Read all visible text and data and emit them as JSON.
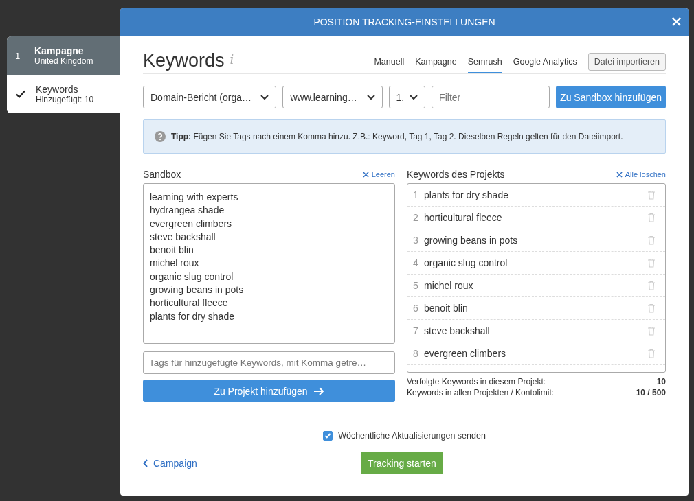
{
  "steps": [
    {
      "number": "1",
      "title": "Kampagne",
      "subtitle": "United Kingdom",
      "done": false,
      "selected": true
    },
    {
      "title": "Keywords",
      "subtitle": "Hinzugefügt: 10",
      "done": true,
      "selected": false
    }
  ],
  "dialog": {
    "title": "POSITION TRACKING-EINSTELLUNGEN"
  },
  "heading": "Keywords",
  "info_icon": "i",
  "tabs": [
    {
      "label": "Manuell",
      "selected": false
    },
    {
      "label": "Kampagne",
      "selected": false
    },
    {
      "label": "Semrush",
      "selected": true
    },
    {
      "label": "Google Analytics",
      "selected": false
    }
  ],
  "import_button": "Datei importieren",
  "selects": [
    {
      "value": "Domain-Bericht (orga…"
    },
    {
      "value": "www.learning…"
    },
    {
      "value": "1."
    }
  ],
  "filter": {
    "placeholder": "Filter"
  },
  "sandbox_button": "Zu Sandbox hinzufügen",
  "tip": "**Tipp:** Fügen Sie Tags nach einem Komma hinzu. Z.B.: Keyword, Tag 1, Tag 2. Dieselben Regeln gelten für den Dateiimport.",
  "sandbox": {
    "label": "Sandbox",
    "clear": "Leeren",
    "lines": [
      "learning with experts",
      "hydrangea shade",
      "evergreen climbers",
      "steve backshall",
      "benoit blin",
      "michel roux",
      "organic slug control",
      "growing beans in pots",
      "horticultural fleece",
      "plants for dry shade"
    ]
  },
  "tags_field": {
    "placeholder": "Tags für hinzugefügte Keywords, mit Komma getre…"
  },
  "add_button": "Zu Projekt hinzufügen",
  "project": {
    "label": "Keywords des Projekts",
    "clear": "Alle löschen",
    "keywords": [
      {
        "number": "1",
        "text": "plants for dry shade"
      },
      {
        "number": "2",
        "text": "horticultural fleece"
      },
      {
        "number": "3",
        "text": "growing beans in pots"
      },
      {
        "number": "4",
        "text": "organic slug control"
      },
      {
        "number": "5",
        "text": "michel roux"
      },
      {
        "number": "6",
        "text": "benoit blin"
      },
      {
        "number": "7",
        "text": "steve backshall"
      },
      {
        "number": "8",
        "text": "evergreen climbers"
      }
    ]
  },
  "stats": [
    {
      "label": "Verfolgte Keywords in diesem Projekt:",
      "value": "10"
    },
    {
      "label": "Keywords in allen Projekten / Kontolimit:",
      "value": "10 / 500"
    }
  ],
  "weekly": {
    "label": "Wöchentliche Aktualisierungen senden",
    "checked": true
  },
  "back_link": "Campaign",
  "start_button": "Tracking starten"
}
